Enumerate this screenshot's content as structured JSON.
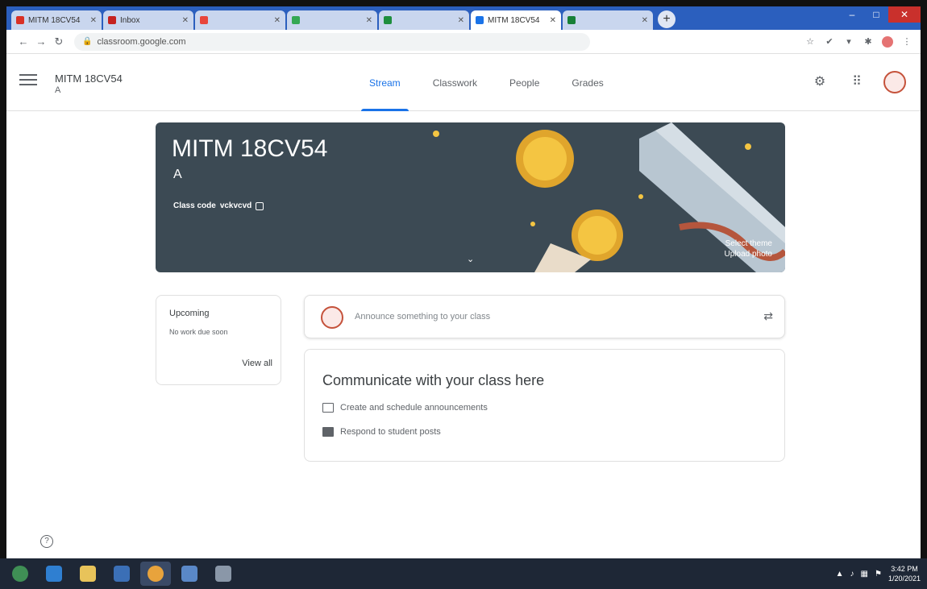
{
  "browser": {
    "tabs": [
      {
        "label": "MITM 18CV54",
        "color": "#d93025",
        "active": false
      },
      {
        "label": "Inbox",
        "color": "#c5221f",
        "active": false
      },
      {
        "label": "",
        "color": "#e8453c",
        "active": false
      },
      {
        "label": "",
        "color": "#34a853",
        "active": false
      },
      {
        "label": "",
        "color": "#1e8e3e",
        "active": false
      },
      {
        "label": "MITM 18CV54",
        "color": "#1a73e8",
        "active": true
      },
      {
        "label": "",
        "color": "#188038",
        "active": false
      }
    ],
    "new_tab_label": "+",
    "url": "classroom.google.com",
    "win_minimize": "–",
    "win_maximize": "□",
    "win_close": "✕"
  },
  "header": {
    "class_title": "MITM 18CV54",
    "class_section": "A",
    "tabs": [
      {
        "label": "Stream",
        "active": true
      },
      {
        "label": "Classwork",
        "active": false
      },
      {
        "label": "People",
        "active": false
      },
      {
        "label": "Grades",
        "active": false
      }
    ]
  },
  "banner": {
    "title": "MITM 18CV54",
    "section": "A",
    "class_code_label": "Class code",
    "class_code": "vckvcvd",
    "select_theme": "Select theme",
    "upload_photo": "Upload photo",
    "bg_color": "#3c4a54"
  },
  "upcoming": {
    "title": "Upcoming",
    "empty_text": "No work due soon",
    "view_all": "View all"
  },
  "announce": {
    "placeholder": "Announce something to your class"
  },
  "communicate": {
    "title": "Communicate with your class here",
    "item_1": "Create and schedule announcements",
    "item_2": "Respond to student posts"
  },
  "taskbar": {
    "time": "3:42 PM",
    "date": "1/20/2021"
  },
  "colors": {
    "accent": "#1a73e8",
    "avatar_ring": "#c5523b"
  }
}
